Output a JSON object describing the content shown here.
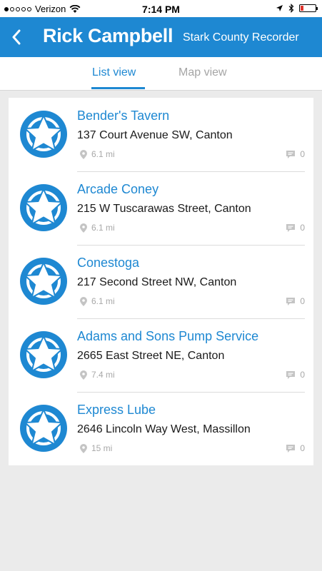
{
  "status_bar": {
    "carrier": "Verizon",
    "time": "7:14 PM"
  },
  "header": {
    "title": "Rick Campbell",
    "subtitle": "Stark County Recorder"
  },
  "tabs": [
    {
      "label": "List view",
      "active": true
    },
    {
      "label": "Map view",
      "active": false
    }
  ],
  "colors": {
    "accent": "#1e88d2"
  },
  "list": [
    {
      "name": "Bender's Tavern",
      "address": "137 Court Avenue SW, Canton",
      "distance": "6.1 mi",
      "comments": "0"
    },
    {
      "name": "Arcade Coney",
      "address": "215 W Tuscarawas Street, Canton",
      "distance": "6.1 mi",
      "comments": "0"
    },
    {
      "name": "Conestoga",
      "address": "217 Second Street NW, Canton",
      "distance": "6.1 mi",
      "comments": "0"
    },
    {
      "name": "Adams and Sons Pump Service",
      "address": "2665 East Street NE, Canton",
      "distance": "7.4 mi",
      "comments": "0"
    },
    {
      "name": "Express Lube",
      "address": "2646 Lincoln Way West, Massillon",
      "distance": "15 mi",
      "comments": "0"
    }
  ]
}
